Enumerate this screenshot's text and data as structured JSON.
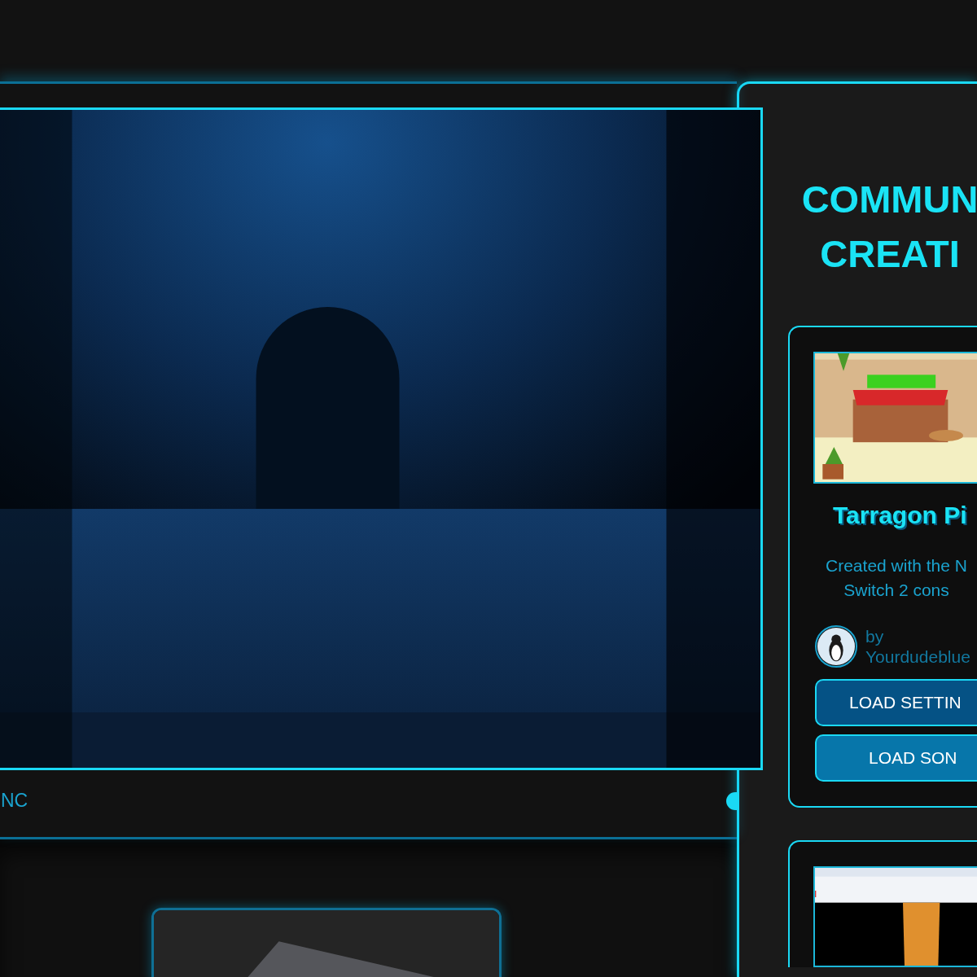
{
  "player": {
    "caption": "NC"
  },
  "community": {
    "heading_lines": [
      "COMMUN",
      "CREATI"
    ],
    "cards": [
      {
        "kind": "full",
        "title": "Tarragon Pi",
        "description": "Created with the N\nSwitch 2 cons",
        "author_prefix": "by",
        "author": "Yourdudeblue",
        "buttons": [
          {
            "label": "LOAD SETTIN",
            "kind": "settings"
          },
          {
            "label": "LOAD SON",
            "kind": "song"
          }
        ]
      },
      {
        "kind": "preview"
      }
    ]
  }
}
